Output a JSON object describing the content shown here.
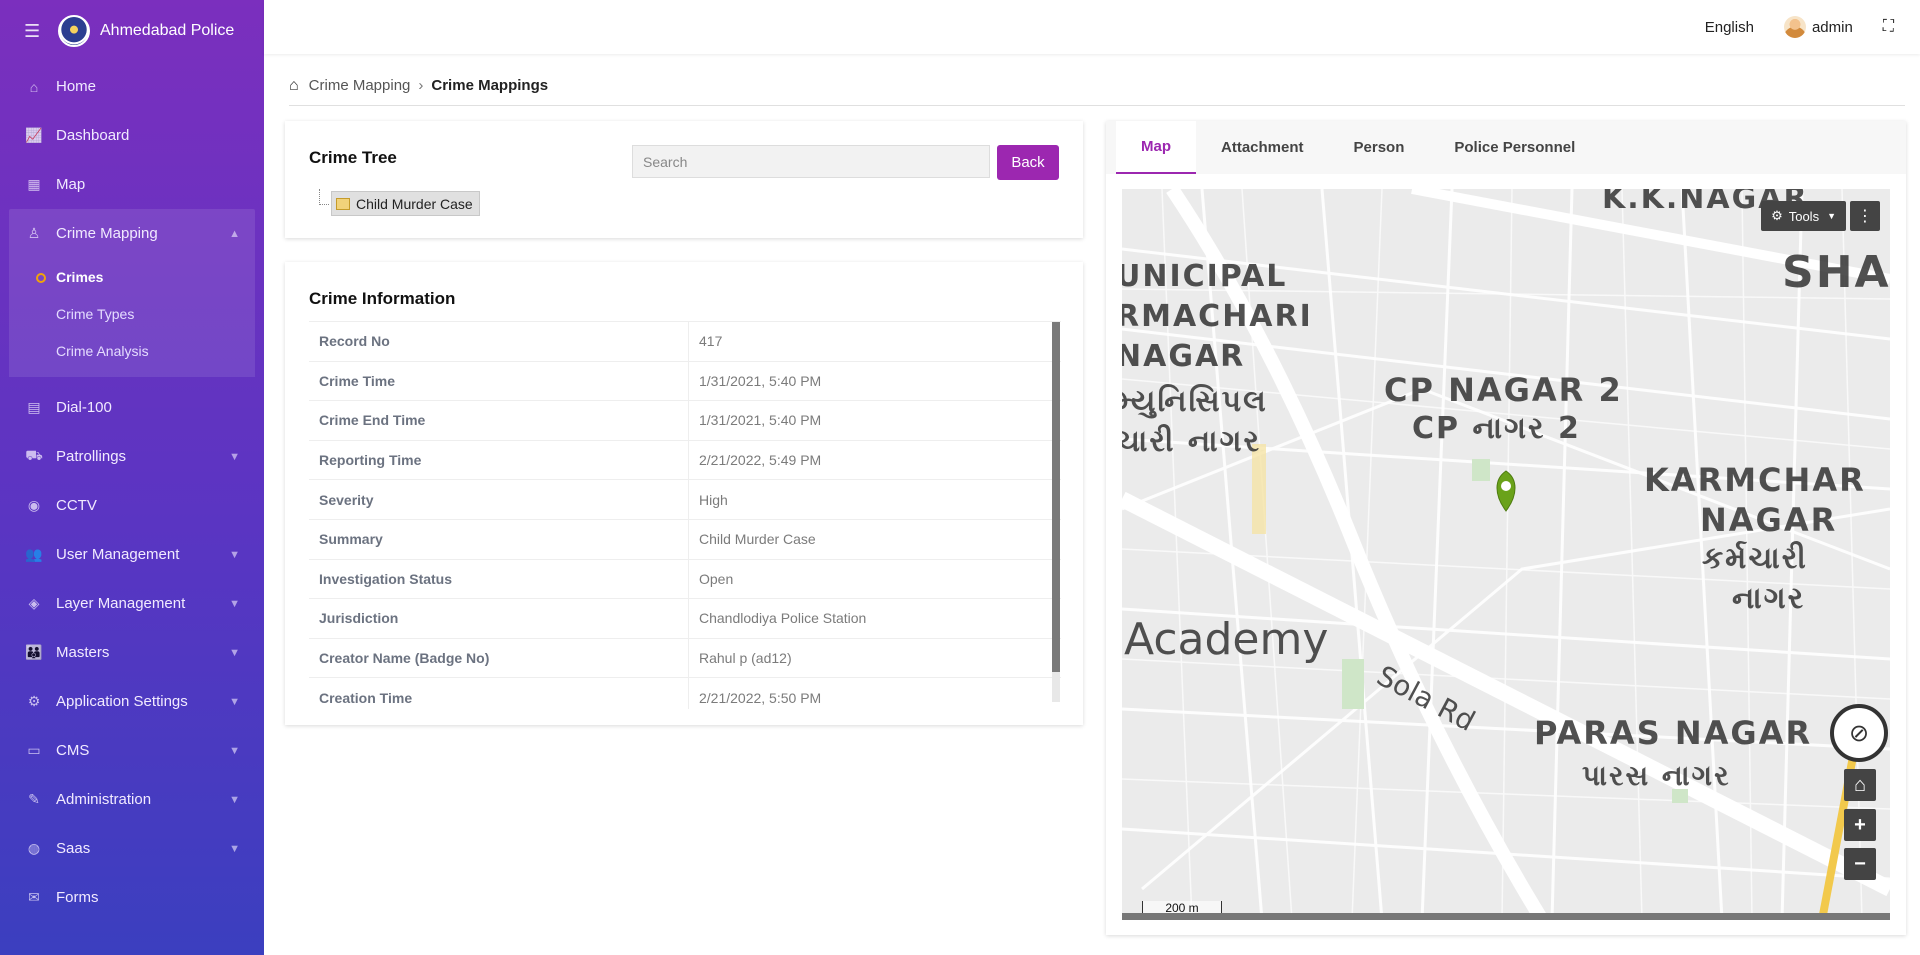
{
  "brand": {
    "name": "Ahmedabad Police"
  },
  "sidebar": {
    "items": [
      {
        "label": "Home",
        "icon": "home-icon",
        "glyph": "⌂",
        "chevron": ""
      },
      {
        "label": "Dashboard",
        "icon": "chart-icon",
        "glyph": "📈",
        "chevron": ""
      },
      {
        "label": "Map",
        "icon": "map-icon",
        "glyph": "▦",
        "chevron": ""
      },
      {
        "label": "Crime Mapping",
        "icon": "crime-icon",
        "glyph": "♙",
        "chevron": "▲",
        "active": true
      },
      {
        "label": "Dial-100",
        "icon": "document-icon",
        "glyph": "▤",
        "chevron": ""
      },
      {
        "label": "Patrollings",
        "icon": "patrol-icon",
        "glyph": "⛟",
        "chevron": "▼"
      },
      {
        "label": "CCTV",
        "icon": "camera-icon",
        "glyph": "◉",
        "chevron": ""
      },
      {
        "label": "User Management",
        "icon": "users-icon",
        "glyph": "👥",
        "chevron": "▼"
      },
      {
        "label": "Layer Management",
        "icon": "layers-icon",
        "glyph": "◈",
        "chevron": "▼"
      },
      {
        "label": "Masters",
        "icon": "masters-icon",
        "glyph": "👪",
        "chevron": "▼"
      },
      {
        "label": "Application Settings",
        "icon": "settings-icon",
        "glyph": "⚙",
        "chevron": "▼"
      },
      {
        "label": "CMS",
        "icon": "cms-icon",
        "glyph": "▭",
        "chevron": "▼"
      },
      {
        "label": "Administration",
        "icon": "wrench-icon",
        "glyph": "✎",
        "chevron": "▼"
      },
      {
        "label": "Saas",
        "icon": "globe-icon",
        "glyph": "◍",
        "chevron": "▼"
      },
      {
        "label": "Forms",
        "icon": "forms-icon",
        "glyph": "✉",
        "chevron": ""
      }
    ],
    "sub_items": [
      {
        "label": "Crimes",
        "current": true
      },
      {
        "label": "Crime Types"
      },
      {
        "label": "Crime Analysis"
      }
    ]
  },
  "topbar": {
    "language": "English",
    "user": "admin"
  },
  "breadcrumb": {
    "parent": "Crime Mapping",
    "current": "Crime Mappings"
  },
  "tree": {
    "title": "Crime Tree",
    "search_placeholder": "Search",
    "back_label": "Back",
    "node_label": "Child Murder Case"
  },
  "info": {
    "title": "Crime Information",
    "rows": [
      {
        "label": "Record No",
        "value": "417"
      },
      {
        "label": "Crime Time",
        "value": "1/31/2021, 5:40 PM"
      },
      {
        "label": "Crime End Time",
        "value": "1/31/2021, 5:40 PM"
      },
      {
        "label": "Reporting Time",
        "value": "2/21/2022, 5:49 PM"
      },
      {
        "label": "Severity",
        "value": "High"
      },
      {
        "label": "Summary",
        "value": "Child Murder Case"
      },
      {
        "label": "Investigation Status",
        "value": "Open"
      },
      {
        "label": "Jurisdiction",
        "value": "Chandlodiya Police Station"
      },
      {
        "label": "Creator Name (Badge No)",
        "value": "Rahul p (ad12)"
      },
      {
        "label": "Creation Time",
        "value": "2/21/2022, 5:50 PM"
      }
    ]
  },
  "tabs": [
    "Map",
    "Attachment",
    "Person",
    "Police Personnel"
  ],
  "map": {
    "tools_label": "Tools",
    "scale_label": "200 m",
    "labels": [
      {
        "text": "K.K.NAGAR"
      },
      {
        "text": "UNICIPAL"
      },
      {
        "text": "RMACHARI"
      },
      {
        "text": "NAGAR"
      },
      {
        "text": "મ્યુનિસિપલ"
      },
      {
        "text": "ચારી નાગર"
      },
      {
        "text": "CP NAGAR 2"
      },
      {
        "text": "CP નાગર 2"
      },
      {
        "text": "SHA"
      },
      {
        "text": "KARMCHAR"
      },
      {
        "text": "NAGAR"
      },
      {
        "text": "કર્મચારી"
      },
      {
        "text": "નાગર"
      },
      {
        "text": "Academy"
      },
      {
        "text": "Sola Rd"
      },
      {
        "text": "PARAS NAGAR"
      },
      {
        "text": "પારસ નાગર"
      }
    ],
    "marker_color": "#6aa21a"
  }
}
